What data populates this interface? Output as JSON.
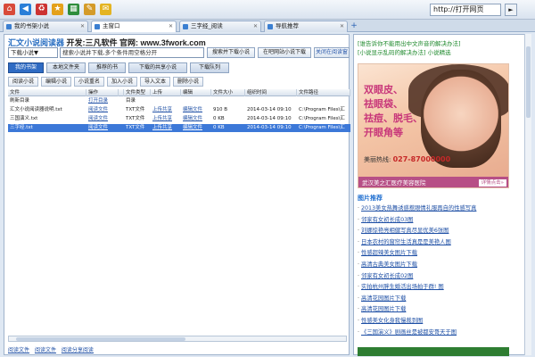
{
  "toolbar": {
    "icons": [
      {
        "name": "home-icon",
        "glyph": "⌂",
        "color": "#d84a3a"
      },
      {
        "name": "back-icon",
        "glyph": "◀",
        "color": "#2a7fd8"
      },
      {
        "name": "recycle-icon",
        "glyph": "♻",
        "color": "#c33"
      },
      {
        "name": "favorites-star-icon",
        "glyph": "★",
        "color": "#e4a11b"
      },
      {
        "name": "grid-icon",
        "glyph": "▦",
        "color": "#2f8d3c"
      },
      {
        "name": "tools-icon",
        "glyph": "✎",
        "color": "#d49b2a"
      },
      {
        "name": "chat-icon",
        "glyph": "✉",
        "color": "#e4b422"
      }
    ],
    "address_value": "http://打开网页",
    "go_label": "►"
  },
  "tabs": [
    {
      "label": "我的书架小说",
      "active": false
    },
    {
      "label": "主窗口",
      "active": true
    },
    {
      "label": "三字经_阅读",
      "active": false
    },
    {
      "label": "导航推荐",
      "active": false
    }
  ],
  "left": {
    "app_title": "汇文小说阅读器",
    "app_dev": "开发:三凡软件 官网: www.3fwork.com",
    "select_value": "下载小说▼",
    "search_value": "搜索小说并下载,多个条件用空格分开",
    "buttons": [
      "搜索并下载小说",
      "在吧网站小说下载",
      "关闭在阅读窗"
    ],
    "main_tabs": [
      "我的书架",
      "本地文件夹",
      "推荐的书",
      "下载的共享小说",
      "下载队列"
    ],
    "sub_tabs": [
      "阅读小说",
      "编辑小说",
      "小说重名",
      "加入小说",
      "导入文本",
      "删除小说"
    ],
    "columns": [
      "文件",
      "操作",
      "",
      "文件类型",
      "上传",
      "编辑",
      "文件大小",
      "组织时间",
      "文件路径"
    ],
    "rows": [
      {
        "name": "刷新目录",
        "op": "打开目录",
        "op2": "",
        "type": "目录",
        "upload": "",
        "edit": "",
        "size": "",
        "time": "",
        "path": "",
        "selected": false
      },
      {
        "name": "汇文小说阅读器说明.txt",
        "op": "阅读文件",
        "op2": "",
        "type": "TXT文件",
        "upload": "上传共享",
        "edit": "编辑文件",
        "size": "910 B",
        "time": "2014-03-14 09:10",
        "path": "C:\\Program Files\\汇",
        "selected": false
      },
      {
        "name": "三国演义.txt",
        "op": "阅读文件",
        "op2": "",
        "type": "TXT文件",
        "upload": "上传共享",
        "edit": "编辑文件",
        "size": "0 KB",
        "time": "2014-03-14 09:10",
        "path": "C:\\Program Files\\汇",
        "selected": false
      },
      {
        "name": "三字经.txt",
        "op": "阅读文件",
        "op2": "",
        "type": "TXT文件",
        "upload": "上传共享",
        "edit": "编辑文件",
        "size": "0 KB",
        "time": "2014-03-14 09:10",
        "path": "C:\\Program Files\\汇",
        "selected": true
      }
    ],
    "status_links": [
      "阅读文件",
      "阅读文件",
      "阅读分享阅读"
    ]
  },
  "right": {
    "top_links": [
      "[谁告诉你不能用出中文声音的解决办法]",
      "[小说显示乱码的解决办法] 小说精选"
    ],
    "ad": {
      "lines": [
        "双眼皮、",
        "祛眼袋、",
        "祛痘、脱毛、",
        "开眼角等"
      ],
      "hotline_label": "美丽热线: ",
      "hotline_number": "027-87000000",
      "bottom_text": "武汉美之汇医疗美容医院",
      "detail_label": "详情点击»"
    },
    "section_title": "图片推荐",
    "news": [
      "2013美女热舞诱惑惹眼情礼服再自的性感写真",
      "邻家有女初长成03图",
      "刘娜惊艳亮相健写真尽显优美6张图",
      "日本农村的窗帘生活真是是美艳人图",
      "性感超辣美女图片下载",
      "高清古典美女图片下载",
      "邻家有女初长成02图",
      "实拍杭州胖生婚活出场拍于群! 图",
      "高清花园图片下载",
      "高清花园图片下载",
      "性感美女化身我慢裁到图",
      "《三国演义》剧画丝是被都安哥天于图"
    ]
  }
}
